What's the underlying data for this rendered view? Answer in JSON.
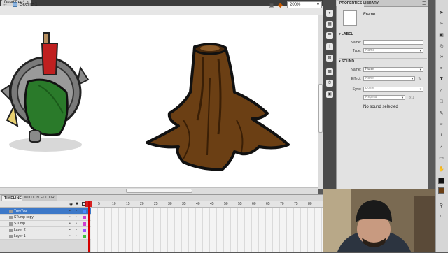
{
  "document": {
    "tab_label": "DeadTree*",
    "close_glyph": "×"
  },
  "edit_bar": {
    "scene_label": "Scene 1",
    "zoom": "200%"
  },
  "timeline": {
    "tabs": [
      "TIMELINE",
      "MOTION EDITOR"
    ],
    "frame_numbers": [
      "5",
      "10",
      "15",
      "20",
      "25",
      "30",
      "35",
      "40",
      "45",
      "50",
      "55",
      "60",
      "65",
      "70",
      "75",
      "80"
    ],
    "layers": [
      {
        "name": "TreeTop",
        "selected": true,
        "swatch": "#4b8cff"
      },
      {
        "name": "STump copy",
        "selected": false,
        "swatch": "#d040d0"
      },
      {
        "name": "STump",
        "selected": false,
        "swatch": "#d040d0"
      },
      {
        "name": "Layer 2",
        "selected": false,
        "swatch": "#a050ff"
      },
      {
        "name": "Layer 1",
        "selected": false,
        "swatch": "#40c040"
      }
    ]
  },
  "properties": {
    "tabs": [
      "PROPERTIES",
      "LIBRARY"
    ],
    "type_label": "Frame",
    "label_section": {
      "title": "LABEL",
      "name_label": "Name:",
      "name_value": "",
      "type_label": "Type:",
      "type_value": "Name"
    },
    "sound_section": {
      "title": "SOUND",
      "name_label": "Name:",
      "name_value": "None",
      "effect_label": "Effect:",
      "effect_value": "None",
      "sync_label": "Sync:",
      "sync_value": "Event",
      "repeat_value": "Repeat",
      "repeat_count": "x 1",
      "status": "No sound selected"
    }
  },
  "colors": {
    "accent": "#3c78c8",
    "playhead": "#d40000",
    "stump": "#6b3f14"
  }
}
